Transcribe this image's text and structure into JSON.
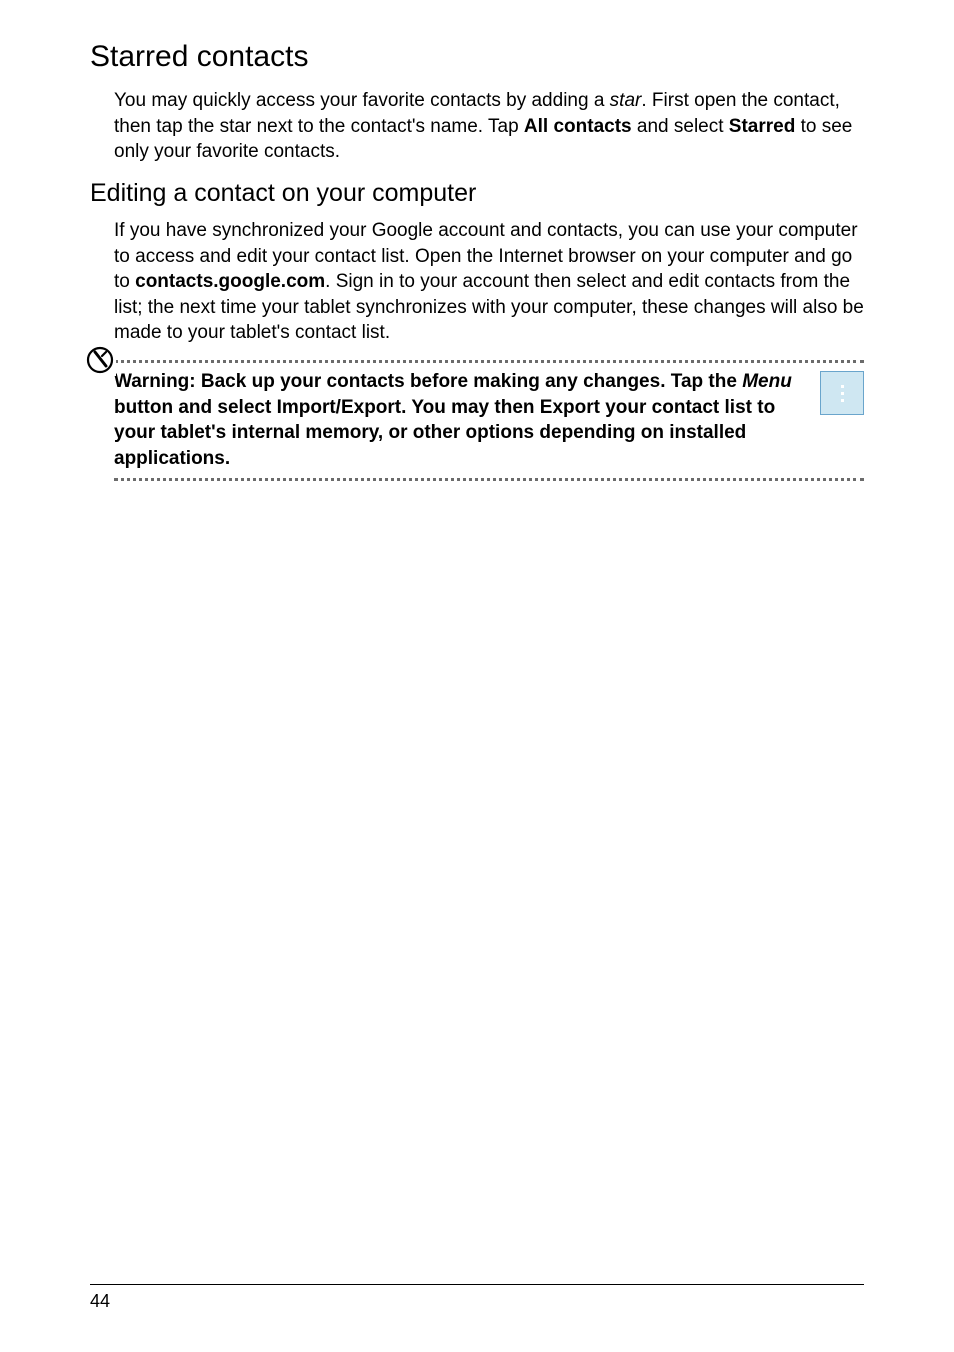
{
  "heading1": "Starred contacts",
  "para1": {
    "t1": "You may quickly access your favorite contacts by adding a ",
    "star": "star",
    "t2": ". First open the contact, then tap the star next to the contact's name. Tap ",
    "all": "All contacts",
    "t3": "  and select ",
    "starred": "Starred",
    "t4": " to see only your favorite contacts."
  },
  "heading2": "Editing a contact on your computer",
  "para2": {
    "t1": "If you have synchronized your Google account and contacts, you can use your computer to access and edit your contact list. Open the Internet browser on your computer and go to ",
    "url": "contacts.google.com",
    "t2": ". Sign in to your account then select and edit contacts from the list; the next time your tablet synchronizes with your computer, these changes will also be made to your tablet's contact list."
  },
  "warning": {
    "t1": "Warning: Back up your contacts before making any changes. Tap the ",
    "menu": "Menu",
    "t2": " button and select Import/Export. You may then Export your contact list to your tablet's internal memory, or other options depending on installed applications."
  },
  "pageNumber": "44"
}
